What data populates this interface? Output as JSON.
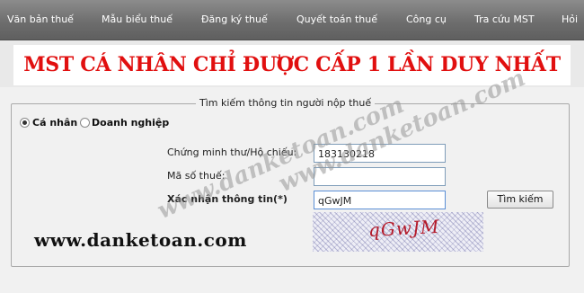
{
  "nav": {
    "items": [
      {
        "label": "Văn bản thuế"
      },
      {
        "label": "Mẫu biểu thuế"
      },
      {
        "label": "Đăng ký thuế"
      },
      {
        "label": "Quyết toán thuế"
      },
      {
        "label": "Công cụ"
      },
      {
        "label": "Tra cứu MST"
      },
      {
        "label": "Hỏi"
      }
    ]
  },
  "banner": {
    "text": "MST CÁ NHÂN CHỈ ĐƯỢC CẤP 1 LẦN DUY NHẤT"
  },
  "search": {
    "legend": "Tìm kiếm thông tin người nộp thuế",
    "radio_personal": "Cá nhân",
    "radio_business": "Doanh nghiệp",
    "selected_type": "Cá nhân",
    "id_label": "Chứng minh thư/Hộ chiếu:",
    "id_value": "183130218",
    "tax_code_label": "Mã số thuế:",
    "tax_code_value": "",
    "verify_label": "Xác nhận thông tin(*)",
    "verify_value": "qGwJM",
    "captcha_text": "qGwJM",
    "search_button": "Tìm kiếm"
  },
  "watermark": {
    "site": "www.danketoan.com",
    "overlay_1": "www.danketoan.com",
    "overlay_2": "www.danketoan.com"
  },
  "colors": {
    "banner_text": "#e10f0f",
    "nav_bg": "#6e6e6e",
    "captcha_text": "#b41a2a"
  }
}
